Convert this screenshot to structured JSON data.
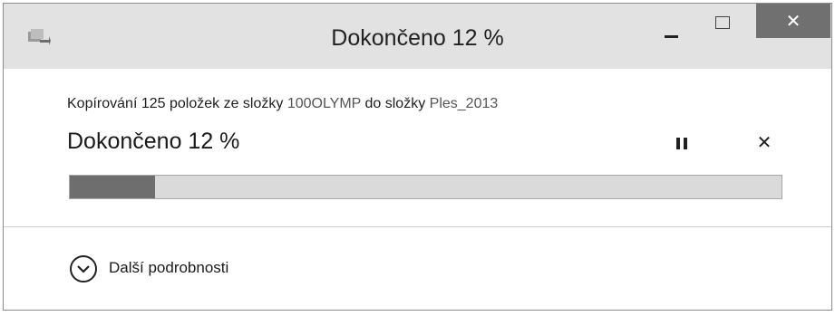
{
  "window": {
    "title": "Dokončeno 12 %",
    "close_glyph": "✕"
  },
  "copy": {
    "prefix": "Kopírování 125 položek ze složky ",
    "source": "100OLYMP",
    "middle": " do složky ",
    "destination": "Ples_2013",
    "status": "Dokončeno 12 %",
    "progress": 0.12,
    "cancel_glyph": "✕"
  },
  "details": {
    "label": "Další podrobnosti"
  },
  "icons": {
    "app": "file-copy-icon",
    "minimize": "minimize-icon",
    "maximize": "maximize-icon",
    "close": "close-icon",
    "pause": "pause-icon",
    "cancel": "cancel-icon",
    "expand": "chevron-down-circle-icon"
  },
  "colors": {
    "titlebar": "#e2e2e2",
    "close_button": "#707070",
    "progress_fill": "#6e6e6e",
    "progress_track": "#dadada"
  }
}
